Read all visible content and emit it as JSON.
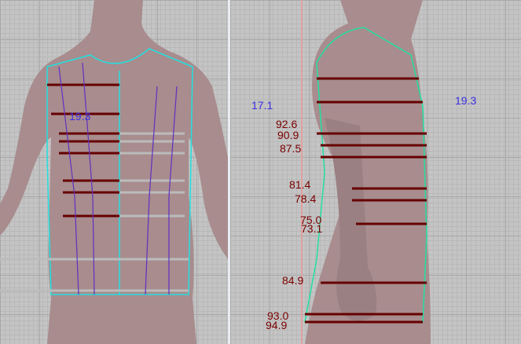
{
  "colors": {
    "measure_red": "#7a0000",
    "measure_blue": "#3a2ee0",
    "pattern_cyan": "#22e0e0",
    "pattern_green": "#22e0a0",
    "skin": "#a88c8e"
  },
  "front_view": {
    "width_label": "19.3"
  },
  "side_view": {
    "front_width_label": "17.1",
    "back_width_label": "19.3",
    "girth_labels": [
      "92.6",
      "90.9",
      "87.5",
      "81.4",
      "78.4",
      "75.0",
      "73.1",
      "84.9",
      "93.0",
      "94.9"
    ]
  }
}
